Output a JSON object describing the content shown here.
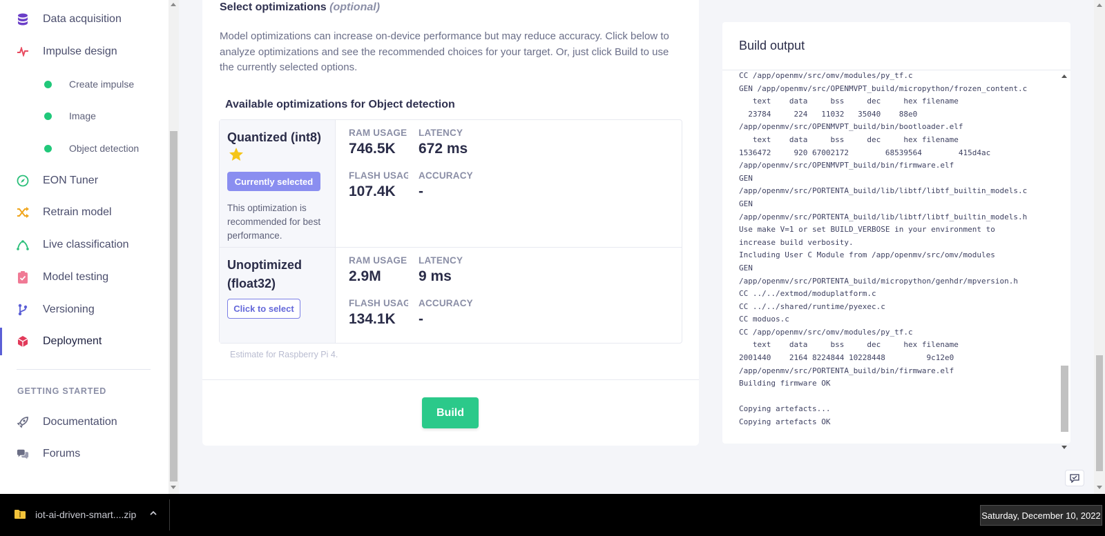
{
  "sidebar": {
    "items": [
      {
        "label": "Data acquisition",
        "icon": "database-icon"
      },
      {
        "label": "Impulse design",
        "icon": "pulse-icon"
      },
      {
        "label": "Create impulse",
        "icon": "status-dot"
      },
      {
        "label": "Image",
        "icon": "status-dot"
      },
      {
        "label": "Object detection",
        "icon": "status-dot"
      },
      {
        "label": "EON Tuner",
        "icon": "compass-icon"
      },
      {
        "label": "Retrain model",
        "icon": "shuffle-icon"
      },
      {
        "label": "Live classification",
        "icon": "bezier-icon"
      },
      {
        "label": "Model testing",
        "icon": "clipboard-check-icon"
      },
      {
        "label": "Versioning",
        "icon": "git-branch-icon"
      },
      {
        "label": "Deployment",
        "icon": "cube-icon"
      }
    ],
    "section_label": "GETTING STARTED",
    "getting_started": [
      {
        "label": "Documentation",
        "icon": "rocket-icon"
      },
      {
        "label": "Forums",
        "icon": "chat-icon"
      }
    ]
  },
  "optimizations": {
    "title": "Select optimizations",
    "title_optional": "(optional)",
    "description": "Model optimizations can increase on-device performance but may reduce accuracy. Click below to analyze optimizations and see the recommended choices for your target. Or, just click Build to use the currently selected options.",
    "available_title": "Available optimizations for Object detection",
    "rows": [
      {
        "name": "Quantized (int8)",
        "button": "Currently selected",
        "note": "This optimization is recommended for best performance.",
        "ram_label": "RAM USAGE",
        "ram_value": "746.5K",
        "latency_label": "LATENCY",
        "latency_value": "672 ms",
        "flash_label": "FLASH USAGE",
        "flash_value": "107.4K",
        "accuracy_label": "ACCURACY",
        "accuracy_value": "-"
      },
      {
        "name": "Unoptimized (float32)",
        "button": "Click to select",
        "ram_label": "RAM USAGE",
        "ram_value": "2.9M",
        "latency_label": "LATENCY",
        "latency_value": "9 ms",
        "flash_label": "FLASH USAGE",
        "flash_value": "134.1K",
        "accuracy_label": "ACCURACY",
        "accuracy_value": "-"
      }
    ],
    "estimate_note": "Estimate for Raspberry Pi 4.",
    "build_label": "Build"
  },
  "build_output": {
    "title": "Build output",
    "lines": [
      "CC /app/openmv/src/omv/modules/py_tf.c",
      "GEN /app/openmv/src/OPENMVPT_build/micropython/frozen_content.c",
      "   text    data     bss     dec     hex filename",
      "  23784     224   11032   35040    88e0",
      "/app/openmv/src/OPENMVPT_build/bin/bootloader.elf",
      "   text    data     bss     dec     hex filename",
      "1536472     920 67002172        68539564        415d4ac",
      "/app/openmv/src/OPENMVPT_build/bin/firmware.elf",
      "GEN",
      "/app/openmv/src/PORTENTA_build/lib/libtf/libtf_builtin_models.c",
      "GEN",
      "/app/openmv/src/PORTENTA_build/lib/libtf/libtf_builtin_models.h",
      "Use make V=1 or set BUILD_VERBOSE in your environment to",
      "increase build verbosity.",
      "Including User C Module from /app/openmv/src/omv/modules",
      "GEN",
      "/app/openmv/src/PORTENTA_build/micropython/genhdr/mpversion.h",
      "CC ../../extmod/moduplatform.c",
      "CC ../../shared/runtime/pyexec.c",
      "CC moduos.c",
      "CC /app/openmv/src/omv/modules/py_tf.c",
      "   text    data     bss     dec     hex filename",
      "2001440    2164 8224844 10228448         9c12e0",
      "/app/openmv/src/PORTENTA_build/bin/firmware.elf",
      "Building firmware OK",
      "",
      "Copying artefacts...",
      "Copying artefacts OK"
    ]
  },
  "taskbar": {
    "download_name": "iot-ai-driven-smart....zip",
    "date_tooltip": "Saturday, December 10, 2022"
  },
  "colors": {
    "accent": "#5b5fd6",
    "selected_button": "#8a8ef0",
    "build_button": "#2bc98a",
    "status_dot": "#21c87a",
    "star": "#f5c518"
  }
}
